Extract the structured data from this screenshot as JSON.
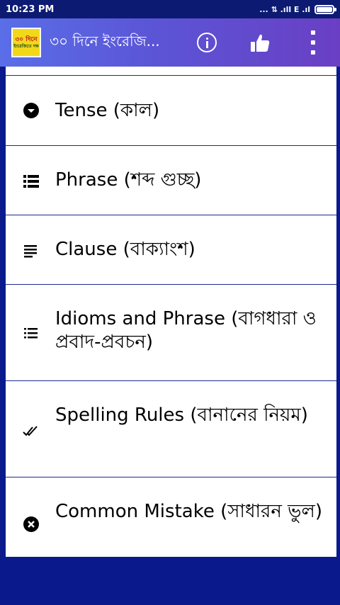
{
  "status_bar": {
    "time": "10:23 PM",
    "signal_text": "... ⇅ .ıll E .ıl"
  },
  "app_bar": {
    "logo_text": "৩০ দিনে",
    "logo_subtext": "ইংরেজিতে দক্ষ",
    "title": "৩০ দিনে ইংরেজি..."
  },
  "list": {
    "items": [
      {
        "icon": "chevron-circle-icon",
        "label": "Tense (কাল)"
      },
      {
        "icon": "list-bold-icon",
        "label": "Phrase (শব্দ  গুচ্ছ)"
      },
      {
        "icon": "lines-icon",
        "label": "Clause (বাক্যাংশ)"
      },
      {
        "icon": "bulleted-list-icon",
        "label": "Idioms and Phrase (বাগধারা ও প্রবাদ-প্রবচন)"
      },
      {
        "icon": "double-check-icon",
        "label": "Spelling Rules (বানানের নিয়ম)"
      },
      {
        "icon": "close-circle-icon",
        "label": "Common Mistake (সাধারন ভুল)"
      }
    ]
  },
  "colors": {
    "nav_blue": "#0a1a8c",
    "app_bar_start": "#5a6ee8",
    "app_bar_end": "#6a3fc4",
    "divider": "#1b2a8a"
  }
}
